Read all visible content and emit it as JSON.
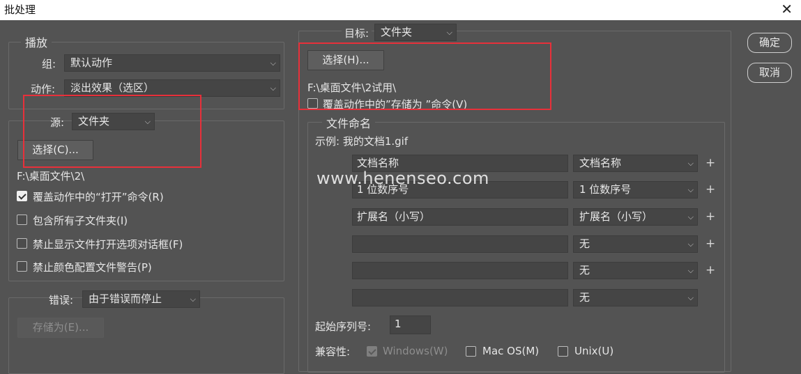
{
  "window": {
    "title": "批处理",
    "close_glyph": "✕"
  },
  "play": {
    "legend": "播放",
    "group_label": "组:",
    "group_value": "默认动作",
    "action_label": "动作:",
    "action_value": "淡出效果（选区）"
  },
  "source": {
    "label": "源:",
    "value": "文件夹",
    "choose_button": "选择(C)...",
    "path": "F:\\桌面文件\\2\\",
    "options": [
      {
        "label": "覆盖动作中的“打开”命令(R)",
        "checked": true
      },
      {
        "label": "包含所有子文件夹(I)",
        "checked": false
      },
      {
        "label": "禁止显示文件打开选项对话框(F)",
        "checked": false
      },
      {
        "label": "禁止颜色配置文件警告(P)",
        "checked": false
      }
    ]
  },
  "errors": {
    "label": "错误:",
    "value": "由于错误而停止",
    "save_as_button": "存储为(E)..."
  },
  "destination": {
    "label": "目标:",
    "value": "文件夹",
    "choose_button": "选择(H)...",
    "path": "F:\\桌面文件\\2试用\\",
    "override_label": "覆盖动作中的”存储为 ”命令(V)",
    "override_checked": false
  },
  "naming": {
    "legend": "文件命名",
    "example": "示例: 我的文档1.gif",
    "rows": [
      {
        "input": "文档名称",
        "select": "文档名称",
        "plus": true
      },
      {
        "input": "1 位数序号",
        "select": "1 位数序号",
        "plus": true
      },
      {
        "input": "扩展名（小写）",
        "select": "扩展名（小写）",
        "plus": true
      },
      {
        "input": "",
        "select": "无",
        "plus": true
      },
      {
        "input": "",
        "select": "无",
        "plus": true
      },
      {
        "input": "",
        "select": "无",
        "plus": false
      }
    ],
    "start_serial_label": "起始序列号:",
    "start_serial_value": "1",
    "compat_label": "兼容性:",
    "compat": [
      {
        "label": "Windows(W)",
        "checked": true,
        "disabled": true
      },
      {
        "label": "Mac OS(M)",
        "checked": false,
        "disabled": false
      },
      {
        "label": "Unix(U)",
        "checked": false,
        "disabled": false
      }
    ]
  },
  "buttons": {
    "ok": "确定",
    "cancel": "取消"
  },
  "watermark": "www.henenseo.com",
  "icons": {
    "dropdown": "chevron-down-icon",
    "plus": "plus-icon",
    "check": "check-icon",
    "close": "close-icon"
  }
}
